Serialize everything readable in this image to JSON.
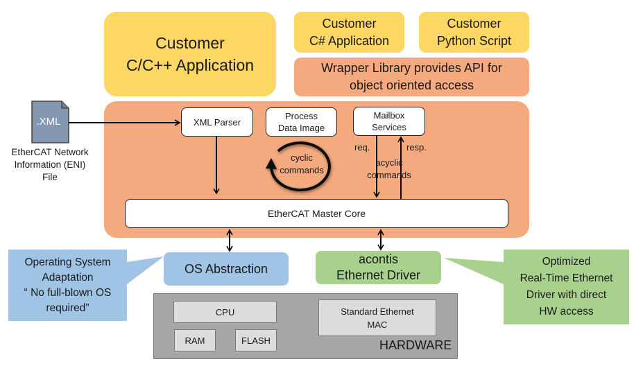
{
  "colors": {
    "customer_app": "#fdd764",
    "master_stack": "#f4a97e",
    "os_layer": "#9fc4e6",
    "driver_layer": "#a9d18e",
    "hardware": "#a6a6a6",
    "hardware_item": "#dcdcdc",
    "eni_file": "#8497b0"
  },
  "customer_apps": {
    "c_cpp": [
      "Customer",
      "C/C++ Application"
    ],
    "csharp": [
      "Customer",
      "C# Application"
    ],
    "python": [
      "Customer",
      "Python Script"
    ]
  },
  "wrapper_library": [
    "Wrapper Library provides API for",
    "object oriented access"
  ],
  "eni_file": {
    "icon_label": ".XML",
    "caption": [
      "EtherCAT Network",
      "Information (ENI)",
      "File"
    ]
  },
  "master_stack": {
    "xml_parser": "XML Parser",
    "process_data_image": [
      "Process",
      "Data Image"
    ],
    "mailbox_services": [
      "Mailbox",
      "Services"
    ],
    "cyclic_label": [
      "cyclic",
      "commands"
    ],
    "acyclic_label": [
      "acyclic",
      "commands"
    ],
    "req_label": "req.",
    "resp_label": "resp.",
    "master_core": "EtherCAT Master Core"
  },
  "os_abstraction": "OS Abstraction",
  "ethernet_driver": [
    "acontis",
    "Ethernet Driver"
  ],
  "os_callout": [
    "Operating System",
    "Adaptation",
    "“ No full-blown OS",
    "required”"
  ],
  "driver_callout": [
    "Optimized",
    "Real-Time Ethernet",
    "Driver with direct",
    "HW access"
  ],
  "hardware": {
    "label": "HARDWARE",
    "cpu": "CPU",
    "ram": "RAM",
    "flash": "FLASH",
    "ethernet_mac": [
      "Standard Ethernet",
      "MAC"
    ]
  }
}
